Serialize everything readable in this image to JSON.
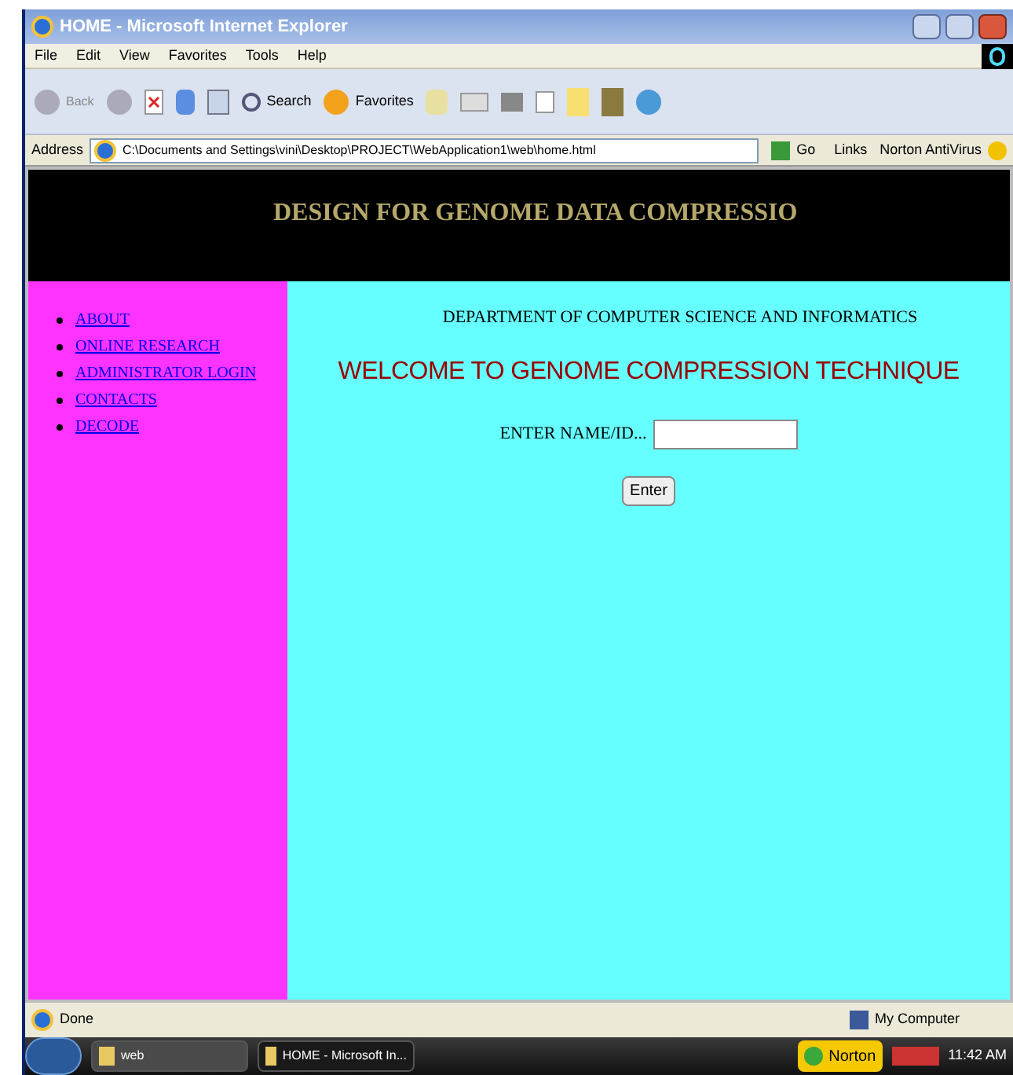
{
  "window": {
    "title": "HOME - Microsoft Internet Explorer"
  },
  "menu": [
    "File",
    "Edit",
    "View",
    "Favorites",
    "Tools",
    "Help"
  ],
  "toolbar": {
    "back": "Back",
    "search": "Search",
    "favorites": "Favorites"
  },
  "address_bar": {
    "label": "Address",
    "value": "C:\\Documents and Settings\\vini\\Desktop\\PROJECT\\WebApplication1\\web\\home.html",
    "go": "Go",
    "links": "Links",
    "norton": "Norton AntiVirus"
  },
  "page": {
    "banner": "DESIGN FOR GENOME DATA COMPRESSIO",
    "nav": [
      "ABOUT",
      "ONLINE RESEARCH",
      "ADMINISTRATOR LOGIN",
      "CONTACTS",
      "DECODE"
    ],
    "department": "DEPARTMENT OF COMPUTER SCIENCE AND INFORMATICS",
    "welcome": "WELCOME TO GENOME COMPRESSION TECHNIQUE",
    "name_label": "ENTER NAME/ID...",
    "enter_button": "Enter"
  },
  "status_bar": {
    "status": "Done",
    "zone": "My Computer"
  },
  "taskbar": {
    "items": [
      {
        "label": "web",
        "selected": false
      },
      {
        "label": "HOME - Microsoft In...",
        "selected": true
      }
    ],
    "norton": "Norton",
    "clock": "11:42 AM"
  }
}
